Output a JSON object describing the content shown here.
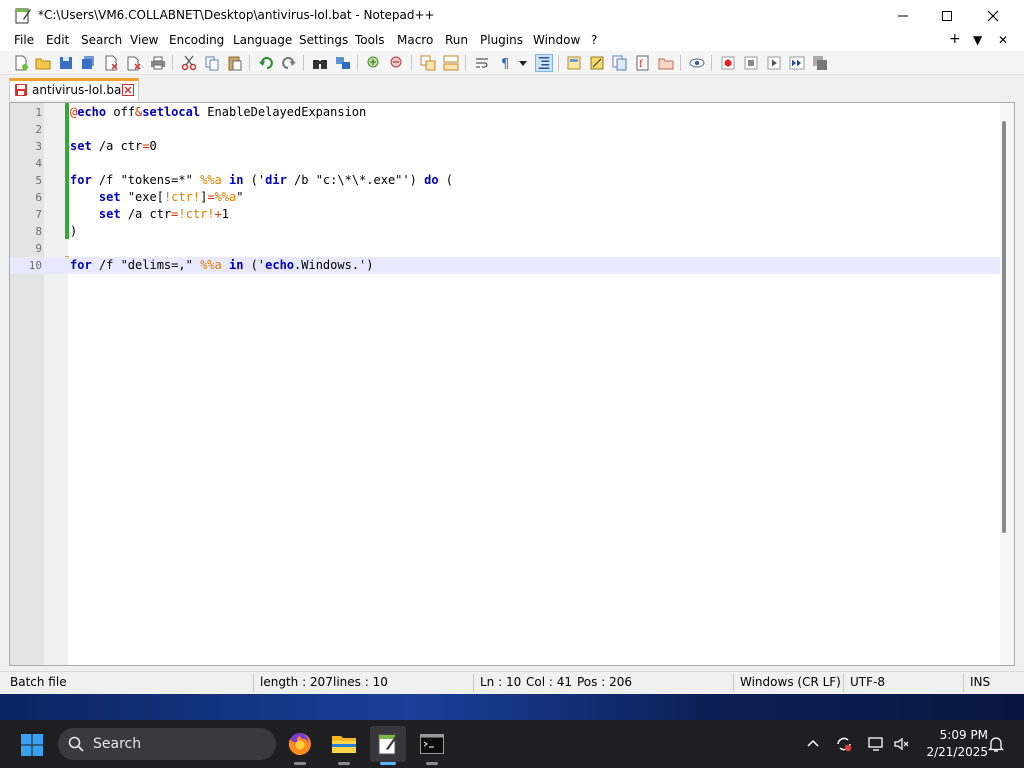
{
  "window": {
    "title": "*C:\\Users\\VM6.COLLABNET\\Desktop\\antivirus-lol.bat - Notepad++"
  },
  "menu": {
    "items": [
      "File",
      "Edit",
      "Search",
      "View",
      "Encoding",
      "Language",
      "Settings",
      "Tools",
      "Macro",
      "Run",
      "Plugins",
      "Window",
      "?"
    ],
    "right": [
      "+",
      "▼",
      "✕"
    ]
  },
  "tab": {
    "label": "antivirus-lol.bat"
  },
  "editor": {
    "line_numbers": [
      "1",
      "2",
      "3",
      "4",
      "5",
      "6",
      "7",
      "8",
      "9",
      "10"
    ],
    "current_line": 10,
    "lines": [
      [
        {
          "t": "@",
          "c": "op"
        },
        {
          "t": "echo",
          "c": "kw"
        },
        {
          "t": " off",
          "c": "plain"
        },
        {
          "t": "&",
          "c": "op"
        },
        {
          "t": "setlocal",
          "c": "kw"
        },
        {
          "t": " EnableDelayedExpansion",
          "c": "plain"
        }
      ],
      [],
      [
        {
          "t": "set",
          "c": "kw"
        },
        {
          "t": " /a ctr",
          "c": "plain"
        },
        {
          "t": "=",
          "c": "op"
        },
        {
          "t": "0",
          "c": "plain"
        }
      ],
      [],
      [
        {
          "t": "for",
          "c": "kw"
        },
        {
          "t": " /f \"tokens=*\" ",
          "c": "plain"
        },
        {
          "t": "%%a",
          "c": "var"
        },
        {
          "t": " ",
          "c": "plain"
        },
        {
          "t": "in",
          "c": "kw"
        },
        {
          "t": " ('",
          "c": "plain"
        },
        {
          "t": "dir",
          "c": "kw"
        },
        {
          "t": " /b \"c:\\*\\*.exe\"') ",
          "c": "plain"
        },
        {
          "t": "do",
          "c": "kw"
        },
        {
          "t": " (",
          "c": "plain"
        }
      ],
      [
        {
          "t": "    ",
          "c": "plain"
        },
        {
          "t": "set",
          "c": "kw"
        },
        {
          "t": " \"exe[",
          "c": "plain"
        },
        {
          "t": "!ctr!",
          "c": "var"
        },
        {
          "t": "]",
          "c": "plain"
        },
        {
          "t": "=",
          "c": "op"
        },
        {
          "t": "%%a",
          "c": "var"
        },
        {
          "t": "\"",
          "c": "plain"
        }
      ],
      [
        {
          "t": "    ",
          "c": "plain"
        },
        {
          "t": "set",
          "c": "kw"
        },
        {
          "t": " /a ctr",
          "c": "plain"
        },
        {
          "t": "=",
          "c": "op"
        },
        {
          "t": "!ctr!",
          "c": "var"
        },
        {
          "t": "+",
          "c": "op"
        },
        {
          "t": "1",
          "c": "plain"
        }
      ],
      [
        {
          "t": ")",
          "c": "plain"
        }
      ],
      [],
      [
        {
          "t": "for",
          "c": "kw"
        },
        {
          "t": " /f \"delims=,\" ",
          "c": "plain"
        },
        {
          "t": "%%a",
          "c": "var"
        },
        {
          "t": " ",
          "c": "plain"
        },
        {
          "t": "in",
          "c": "kw"
        },
        {
          "t": " ('",
          "c": "plain"
        },
        {
          "t": "echo",
          "c": "kw"
        },
        {
          "t": ".Windows.')",
          "c": "plain"
        }
      ]
    ]
  },
  "status": {
    "language": "Batch file",
    "length": "length : 207",
    "lines": "lines : 10",
    "ln": "Ln : 10",
    "col": "Col : 41",
    "pos": "Pos : 206",
    "eol": "Windows (CR LF)",
    "encoding": "UTF-8",
    "mode": "INS"
  },
  "taskbar": {
    "search_label": "Search",
    "time": "5:09 PM",
    "date": "2/21/2025"
  },
  "colors": {
    "keyword": "#0000c0",
    "variable": "#e08000",
    "operator": "#e03000",
    "current_line": "#e8e8ff",
    "tab_accent": "#f2a030"
  }
}
